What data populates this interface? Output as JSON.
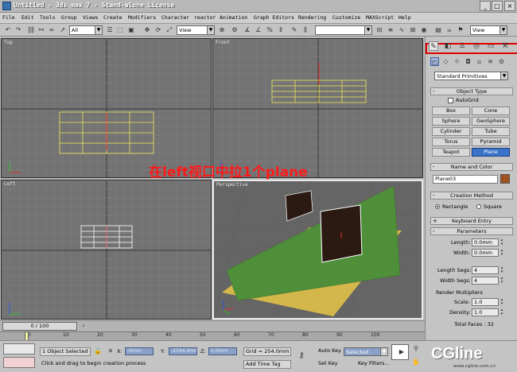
{
  "window": {
    "title": "Untitled  - 3ds max 7  - Stand-alone License",
    "minimize_glyph": "_",
    "maximize_glyph": "□",
    "close_glyph": "×"
  },
  "menu": [
    "File",
    "Edit",
    "Tools",
    "Group",
    "Views",
    "Create",
    "Modifiers",
    "Character",
    "reactor",
    "Animation",
    "Graph Editors",
    "Rendering",
    "Customize",
    "MAXScript",
    "Help"
  ],
  "toolbar": {
    "selection_filter": "All",
    "reference_coord_1": "View",
    "reference_coord_2": "View",
    "named_selection_set": ""
  },
  "viewports": {
    "top_label": "Top",
    "front_label": "Front",
    "left_label": "Left",
    "perspective_label": "Perspective"
  },
  "annotation": "在left视口中拉1个plane",
  "command_panel": {
    "category_dropdown": "Standard Primitives",
    "object_type": {
      "header": "Object Type",
      "autogrid_label": "AutoGrid",
      "buttons": [
        "Box",
        "Cone",
        "Sphere",
        "GeoSphere",
        "Cylinder",
        "Tube",
        "Torus",
        "Pyramid",
        "Teapot",
        "Plane"
      ],
      "selected": "Plane"
    },
    "name_and_color": {
      "header": "Name and Color",
      "name_value": "Plane03",
      "swatch_color": "#a0521e"
    },
    "creation_method": {
      "header": "Creation Method",
      "options": [
        "Rectangle",
        "Square"
      ],
      "selected": "Rectangle"
    },
    "keyboard_entry": {
      "header": "Keyboard Entry",
      "toggle": "+"
    },
    "parameters": {
      "header": "Parameters",
      "length_label": "Length:",
      "length_value": "0.0mm",
      "width_label": "Width:",
      "width_value": "0.0mm",
      "length_segs_label": "Length Segs:",
      "length_segs_value": "4",
      "width_segs_label": "Width Segs:",
      "width_segs_value": "4",
      "render_multipliers_label": "Render Multipliers",
      "scale_label": "Scale:",
      "scale_value": "1.0",
      "density_label": "Density:",
      "density_value": "1.0",
      "total_faces": "Total Faces : 32"
    },
    "collapse_glyph": "-"
  },
  "timeline": {
    "slider_label": "0 / 100",
    "ticks": [
      "0",
      "10",
      "20",
      "30",
      "40",
      "50",
      "60",
      "70",
      "80",
      "90",
      "100"
    ]
  },
  "status": {
    "selection_count": "1 Object Selected",
    "prompt": "Click and drag to begin creation process",
    "x_label": "X:",
    "x_value": "-0mm",
    "y_label": "Y:",
    "y_value": "-2544.0mm",
    "z_label": "Z:",
    "z_value": "0.0mm",
    "grid": "Grid = 254.0mm",
    "add_time_tag": "Add Time Tag",
    "auto_key": "Auto Key",
    "set_key": "Set Key",
    "selected_dropdown": "Selected",
    "key_filters": "Key Filters..."
  },
  "watermark": {
    "logo_text": "CGline",
    "url_text": "www.cgline.com.cn"
  },
  "colors": {
    "viewport_bg": "#737373",
    "grid_line": "#838383",
    "grid_major": "#3a3a3a",
    "selected_plane_yellow": "#f0e65a",
    "green_plane": "#4f8f3a",
    "ground_plane": "#d4b74a",
    "dark_plane": "#2a1a12",
    "annotation_red": "#ff1a1a",
    "highlight_red": "#e00000",
    "selected_button_blue": "#3a73c8"
  }
}
